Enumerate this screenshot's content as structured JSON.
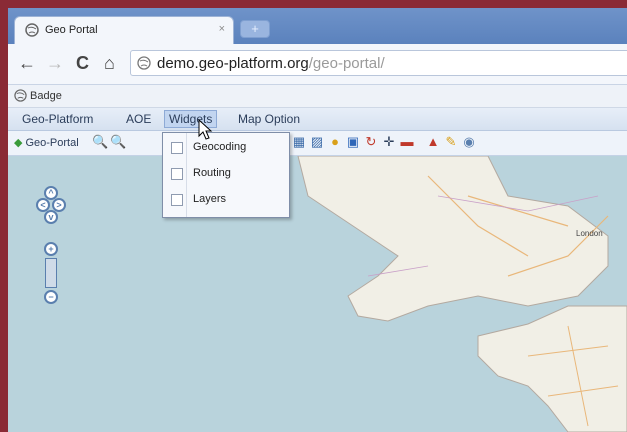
{
  "browser": {
    "tab_title": "Geo Portal",
    "tab_close": "×",
    "new_tab": "+",
    "url_host": "demo.geo-platform.org",
    "url_path": "/geo-portal/",
    "bookmark": "Badge"
  },
  "app": {
    "menu": [
      {
        "label": "Geo-Platform"
      },
      {
        "label": "AOE"
      },
      {
        "label": "Widgets"
      },
      {
        "label": "Map Option"
      }
    ],
    "toolbar_label": "Geo-Portal",
    "widgets_menu": [
      "Geocoding",
      "Routing",
      "Layers"
    ]
  },
  "map": {
    "places": [
      "London"
    ]
  },
  "colors": {
    "accent": "#5a7fae",
    "water": "#b9d3dc",
    "land": "#f1efe6"
  }
}
